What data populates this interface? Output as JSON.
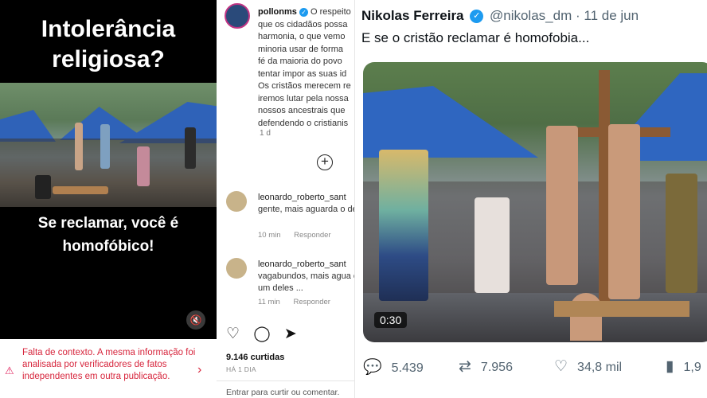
{
  "story": {
    "title": "Intolerância religiosa?",
    "subtitle": "Se reclamar, você é homofóbico!",
    "mute_icon": "speaker-mute-icon",
    "fact_check": "Falta de contexto. A mesma informação foi analisada por verificadores de fatos independentes em outra publicação."
  },
  "instagram": {
    "post_user": "pollonms",
    "caption_lines": [
      "O respeito",
      "que os cidadãos possa",
      "harmonia, o que vemo",
      "minoria usar de forma",
      "fé da maioria do povo",
      "tentar impor as suas id",
      "Os cristãos merecem re",
      "iremos lutar pela nossa",
      "nossos ancestrais que",
      "defendendo o cristianis"
    ],
    "caption_time": "1 d",
    "comments": [
      {
        "user": "leonardo_roberto_sant",
        "text": "gente, mais aguarda o deles ...",
        "time": "10 min",
        "reply": "Responder"
      },
      {
        "user": "leonardo_roberto_sant",
        "text": "vagabundos, mais agua cada um deles ...",
        "time": "11 min",
        "reply": "Responder"
      }
    ],
    "likes": "9.146 curtidas",
    "date": "HÁ 1 DIA",
    "login_prompt": "Entrar para curtir ou comentar."
  },
  "tweet": {
    "name": "Nikolas Ferreira",
    "handle": "@nikolas_dm",
    "separator": "·",
    "date": "11 de jun",
    "text": "E se o cristão reclamar é homofobia...",
    "video_duration": "0:30",
    "replies": "5.439",
    "retweets": "7.956",
    "likes": "34,8 mil",
    "views": "1,9"
  }
}
